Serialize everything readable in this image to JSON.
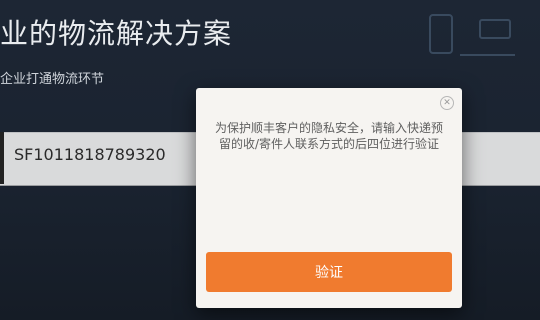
{
  "background": {
    "title": "业的物流解决方案",
    "subtitle": "企业打通物流环节"
  },
  "search": {
    "value": "SF1011818789320"
  },
  "modal": {
    "message": "为保护顺丰客户的隐私安全，请输入快递预留的收/寄件人联系方式的后四位进行验证",
    "close_icon": "close-icon",
    "confirm_label": "验证"
  },
  "colors": {
    "accent": "#f07b2f",
    "page_background": "#1d2634",
    "dialog_background": "#f6f4f1"
  }
}
